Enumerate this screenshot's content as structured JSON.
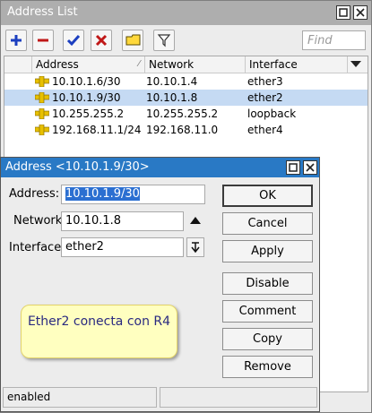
{
  "list_window": {
    "title": "Address List",
    "find_placeholder": "Find",
    "columns": [
      "Address",
      "Network",
      "Interface"
    ],
    "rows": [
      {
        "address": "10.10.1.6/30",
        "network": "10.10.1.4",
        "interface": "ether3",
        "selected": false
      },
      {
        "address": "10.10.1.9/30",
        "network": "10.10.1.8",
        "interface": "ether2",
        "selected": true
      },
      {
        "address": "10.255.255.2",
        "network": "10.255.255.2",
        "interface": "loopback",
        "selected": false
      },
      {
        "address": "192.168.11.1/24",
        "network": "192.168.11.0",
        "interface": "ether4",
        "selected": false
      }
    ],
    "toolbar_icons": [
      "add-icon",
      "remove-icon",
      "enable-check-icon",
      "disable-x-icon",
      "comment-icon",
      "filter-icon"
    ]
  },
  "dialog": {
    "title": "Address <10.10.1.9/30>",
    "address_label": "Address:",
    "address_value": "10.10.1.9/30",
    "network_label": "Network:",
    "network_value": "10.10.1.8",
    "interface_label": "Interface:",
    "interface_value": "ether2",
    "buttons": {
      "ok": "OK",
      "cancel": "Cancel",
      "apply": "Apply",
      "disable": "Disable",
      "comment": "Comment",
      "copy": "Copy",
      "remove": "Remove"
    },
    "status": "enabled"
  },
  "note": "Ether2 conecta con R4",
  "colors": {
    "dialog_title_bg": "#2979c5",
    "selected_row_bg": "#c5daf3",
    "note_bg": "#ffffc0",
    "note_text": "#2a2a80"
  }
}
